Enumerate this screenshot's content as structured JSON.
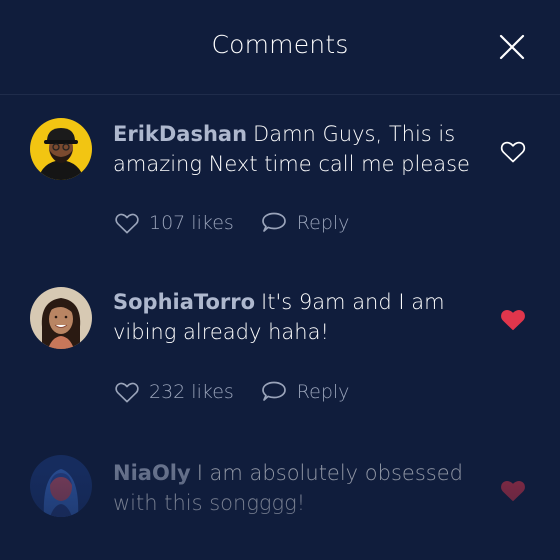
{
  "header": {
    "title": "Comments",
    "close_icon": "close-icon"
  },
  "colors": {
    "background": "#101d3c",
    "username": "#aeb8ce",
    "muted": "#9aa4ba",
    "liked_heart": "#e0364c"
  },
  "comments": [
    {
      "username": "ErikDashan",
      "text": "Damn Guys, This is amazing Next time call me please",
      "liked": false,
      "likes_label": "107 likes",
      "reply_label": "Reply",
      "avatar": "man-with-cap-avatar"
    },
    {
      "username": "SophiaTorro",
      "text": "It's 9am and I am vibing already haha!",
      "liked": true,
      "likes_label": "232 likes",
      "reply_label": "Reply",
      "avatar": "woman-smiling-avatar"
    },
    {
      "username": "NiaOly",
      "text": "I am absolutely obsessed with this songggg!",
      "liked": true,
      "avatar": "woman-neon-avatar"
    }
  ]
}
